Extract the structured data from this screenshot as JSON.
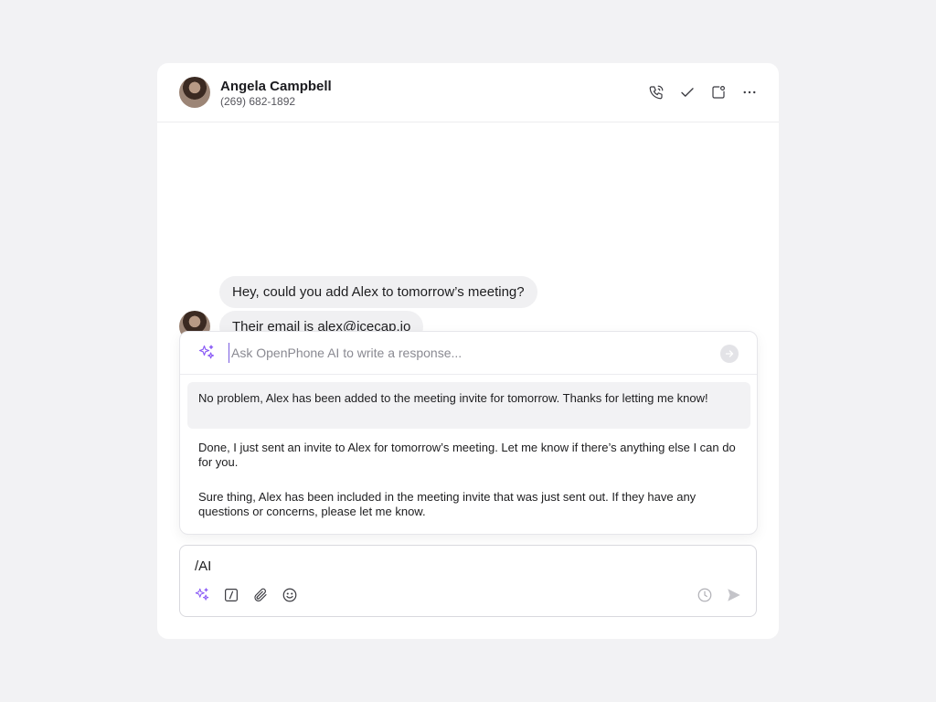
{
  "contact": {
    "name": "Angela Campbell",
    "phone": "(269) 682-1892"
  },
  "header_actions": [
    "phone-icon",
    "check-icon",
    "snooze-icon",
    "more-icon"
  ],
  "messages": [
    {
      "text": "Hey, could you add Alex to tomorrow’s meeting?"
    },
    {
      "text": "Their email is alex@icecap.io"
    }
  ],
  "ai": {
    "placeholder": "Ask OpenPhone AI to write a response...",
    "suggestions": [
      {
        "text": "No problem, Alex has been added to the meeting invite for tomorrow. Thanks for letting me know!",
        "selected": true
      },
      {
        "text": "Done, I just sent an invite to Alex for tomorrow’s meeting. Let me know if there’s anything else I can do for you.",
        "selected": false
      },
      {
        "text": "Sure thing, Alex has been included in the meeting invite that was just sent out. If they have any questions or concerns, please let me know.",
        "selected": false
      }
    ]
  },
  "composer": {
    "value": "/AI",
    "tools": [
      "sparkle-icon",
      "slash-command-icon",
      "paperclip-icon",
      "emoji-icon"
    ],
    "right_tools": [
      "clock-icon",
      "send-icon"
    ]
  },
  "colors": {
    "accent": "#8b5cf6",
    "bubble": "#f0f0f2",
    "background": "#f2f2f4"
  }
}
